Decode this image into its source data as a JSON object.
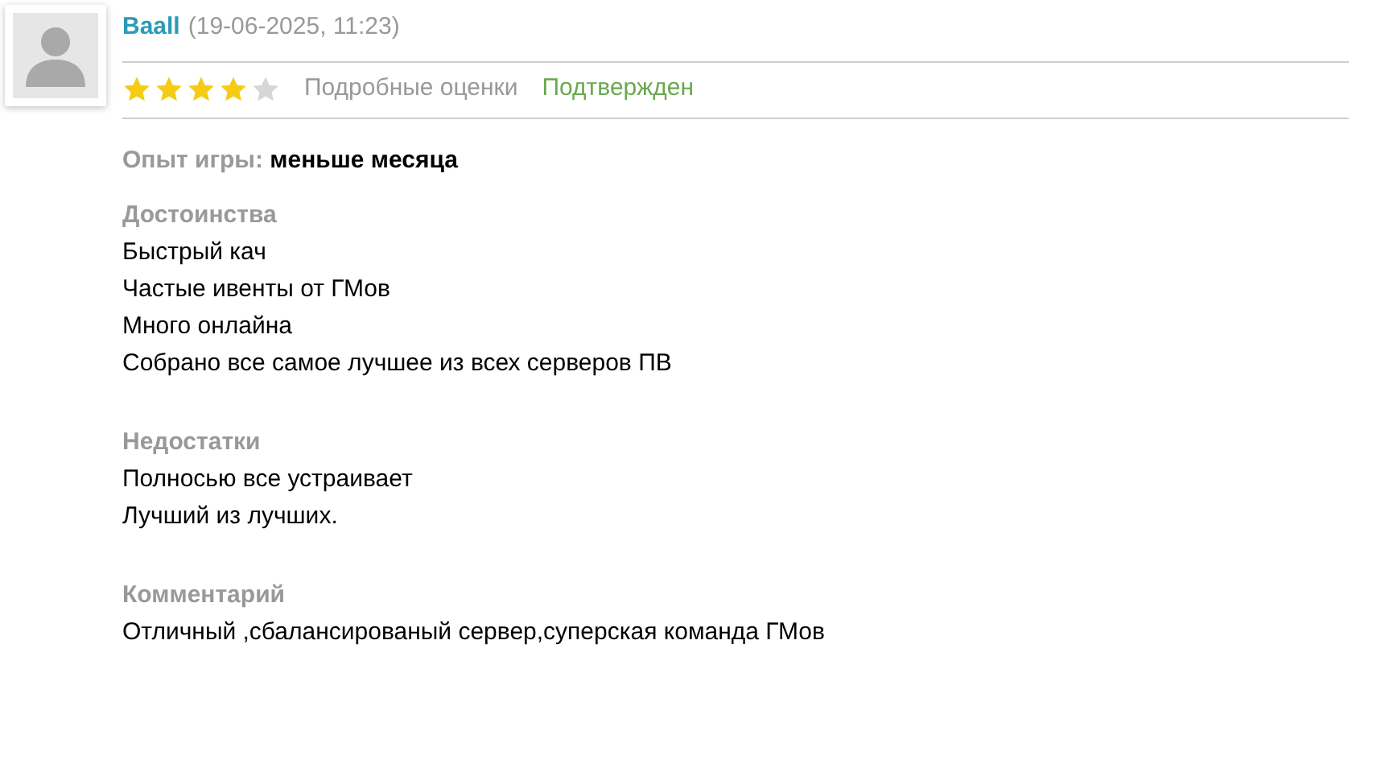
{
  "review": {
    "author": "Baall",
    "date": "(19-06-2025, 11:23)",
    "stars": 4,
    "details_link": "Подробные оценки",
    "status": "Подтвержден",
    "experience": {
      "label": "Опыт игры:",
      "value": "меньше месяца"
    },
    "sections": [
      {
        "title": "Достоинства",
        "lines": [
          "Быстрый кач",
          "Частые ивенты от ГМов",
          "Много онлайна",
          "Собрано все самое лучшее из всех серверов ПВ"
        ]
      },
      {
        "title": "Недостатки",
        "lines": [
          "Полносью все устраивает",
          "Лучший из лучших."
        ]
      },
      {
        "title": "Комментарий",
        "lines": [
          "Отличный ,сбалансированый сервер,суперская команда ГМов"
        ]
      }
    ]
  }
}
